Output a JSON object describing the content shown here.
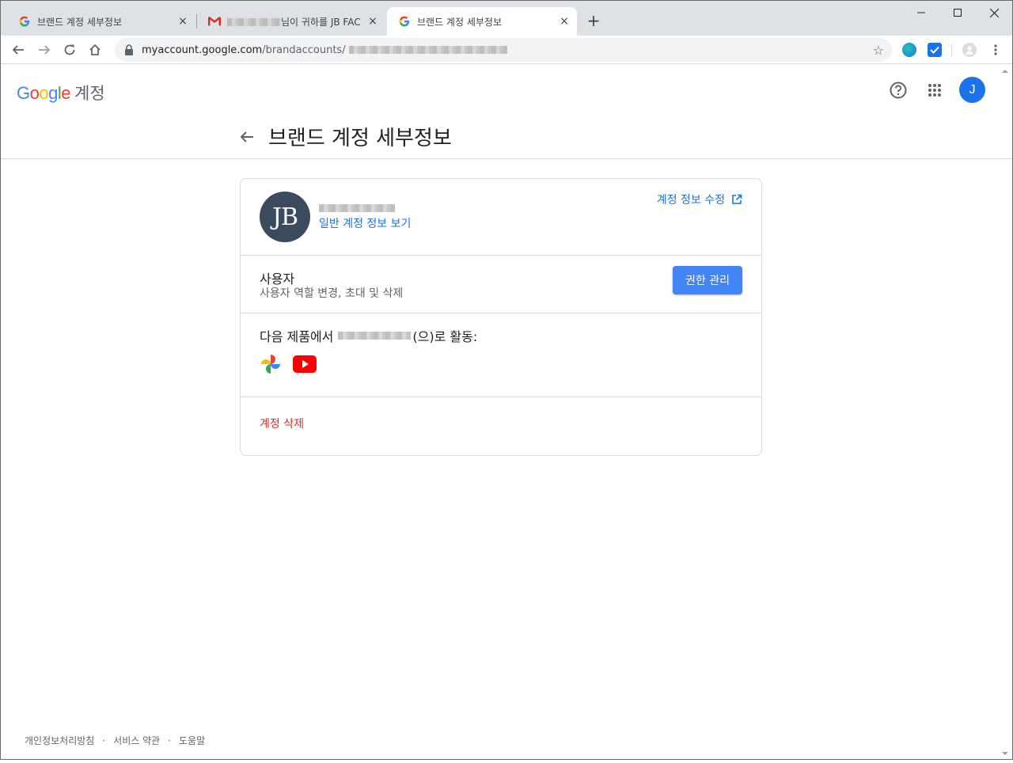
{
  "browser": {
    "tabs": [
      {
        "title": "브랜드 계정 세부정보",
        "favicon": "google-g-icon",
        "active": false
      },
      {
        "title": "님이 귀하를 JB FAC",
        "favicon": "gmail-icon",
        "active": false
      },
      {
        "title": "브랜드 계정 세부정보",
        "favicon": "google-g-icon",
        "active": true
      }
    ],
    "new_tab_symbol": "+",
    "close_symbol": "×",
    "url_host": "myaccount.google.com",
    "url_path": "/brandaccounts/"
  },
  "header": {
    "logo_text": "Google",
    "product_label": "계정",
    "avatar_initial": "J",
    "avatar_color": "#1a73e8"
  },
  "page": {
    "title": "브랜드 계정 세부정보"
  },
  "card": {
    "brand_avatar_initials": "JB",
    "view_link": "일반 계정 정보 보기",
    "edit_link": "계정 정보 수정",
    "users_title": "사용자",
    "users_subtitle": "사용자 역할 변경, 초대 및 삭제",
    "manage_button": "권한 관리",
    "products_prefix": "다음 제품에서",
    "products_suffix": "(으)로 활동:",
    "products": [
      "google-photos-icon",
      "youtube-icon"
    ],
    "delete_link": "계정 삭제"
  },
  "footer": {
    "links": [
      "개인정보처리방침",
      "서비스 약관",
      "도움말"
    ],
    "separator": "·"
  },
  "colors": {
    "link": "#1a73e8",
    "primary_button": "#4285f4",
    "danger": "#d93025"
  }
}
